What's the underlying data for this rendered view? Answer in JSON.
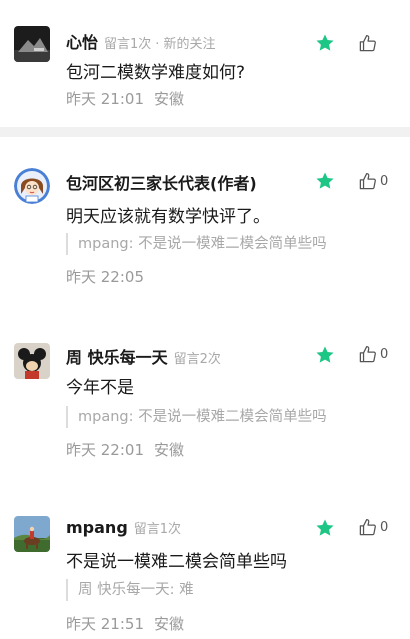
{
  "comments": [
    {
      "name": "心怡",
      "meta_count": "留言1次",
      "meta_tag": "新的关注",
      "text": "包河二模数学难度如何?",
      "quote": "",
      "time": "昨天 21:01",
      "location": "安徽",
      "likes": "",
      "avatar_icon": "dark-landscape-avatar"
    },
    {
      "name": "包河区初三家长代表(作者)",
      "meta_count": "",
      "meta_tag": "",
      "text": "明天应该就有数学快评了。",
      "quote": "mpang: 不是说一模难二模会简单些吗",
      "time": "昨天 22:05",
      "location": "",
      "likes": "0",
      "avatar_icon": "cartoon-girl-avatar"
    },
    {
      "name": "周 快乐每一天",
      "meta_count": "留言2次",
      "meta_tag": "",
      "text": "今年不是",
      "quote": "mpang: 不是说一模难二模会简单些吗",
      "time": "昨天 22:01",
      "location": "安徽",
      "likes": "0",
      "avatar_icon": "mickey-avatar"
    },
    {
      "name": "mpang",
      "meta_count": "留言1次",
      "meta_tag": "",
      "text": "不是说一模难二模会简单些吗",
      "quote": "周 快乐每一天: 难",
      "time": "昨天 21:51",
      "location": "安徽",
      "likes": "0",
      "avatar_icon": "horse-rider-avatar"
    }
  ],
  "colors": {
    "star": "#1ec686",
    "meta": "#a8a8a8",
    "separator": "#f1f1f1"
  }
}
